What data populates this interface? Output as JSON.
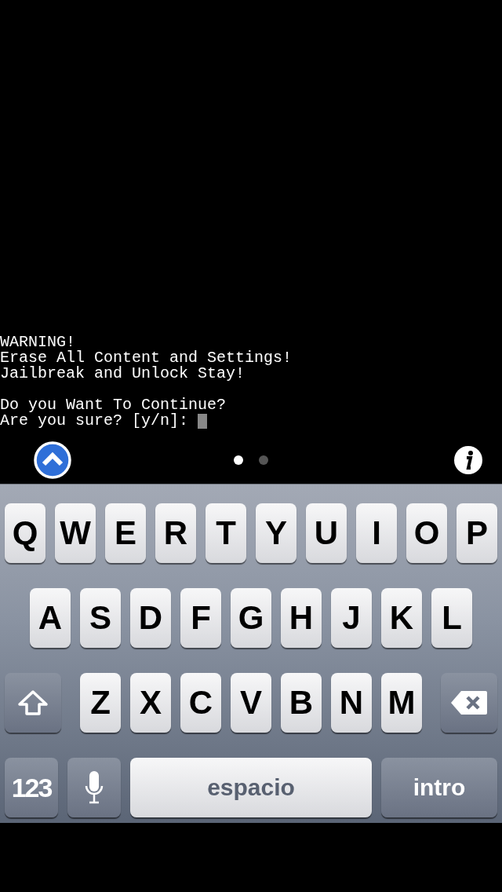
{
  "terminal": {
    "blocks": [
      [
        "WARNING!",
        "Erase All Content and Settings!",
        "Jailbreak and Unlock Stay!"
      ],
      [
        "Do you Want To Continue?",
        "Are you sure? [y/n]:"
      ]
    ],
    "cursor": true
  },
  "pages": [
    {
      "selected": true
    },
    {
      "selected": false
    }
  ],
  "keyboard": {
    "rows": [
      [
        {
          "kind": "letter",
          "label": "Q"
        },
        {
          "kind": "letter",
          "label": "W"
        },
        {
          "kind": "letter",
          "label": "E"
        },
        {
          "kind": "letter",
          "label": "R"
        },
        {
          "kind": "letter",
          "label": "T"
        },
        {
          "kind": "letter",
          "label": "Y"
        },
        {
          "kind": "letter",
          "label": "U"
        },
        {
          "kind": "letter",
          "label": "I"
        },
        {
          "kind": "letter",
          "label": "O"
        },
        {
          "kind": "letter",
          "label": "P"
        }
      ],
      [
        {
          "kind": "letter",
          "label": "A"
        },
        {
          "kind": "letter",
          "label": "S"
        },
        {
          "kind": "letter",
          "label": "D"
        },
        {
          "kind": "letter",
          "label": "F"
        },
        {
          "kind": "letter",
          "label": "G"
        },
        {
          "kind": "letter",
          "label": "H"
        },
        {
          "kind": "letter",
          "label": "J"
        },
        {
          "kind": "letter",
          "label": "K"
        },
        {
          "kind": "letter",
          "label": "L"
        }
      ],
      [
        {
          "kind": "shift"
        },
        {
          "kind": "letter",
          "label": "Z"
        },
        {
          "kind": "letter",
          "label": "X"
        },
        {
          "kind": "letter",
          "label": "C"
        },
        {
          "kind": "letter",
          "label": "V"
        },
        {
          "kind": "letter",
          "label": "B"
        },
        {
          "kind": "letter",
          "label": "N"
        },
        {
          "kind": "letter",
          "label": "M"
        },
        {
          "kind": "delete"
        }
      ]
    ],
    "bottom_row": {
      "numbers_key": "123",
      "space_key": "espacio",
      "return_key": "intro"
    }
  }
}
